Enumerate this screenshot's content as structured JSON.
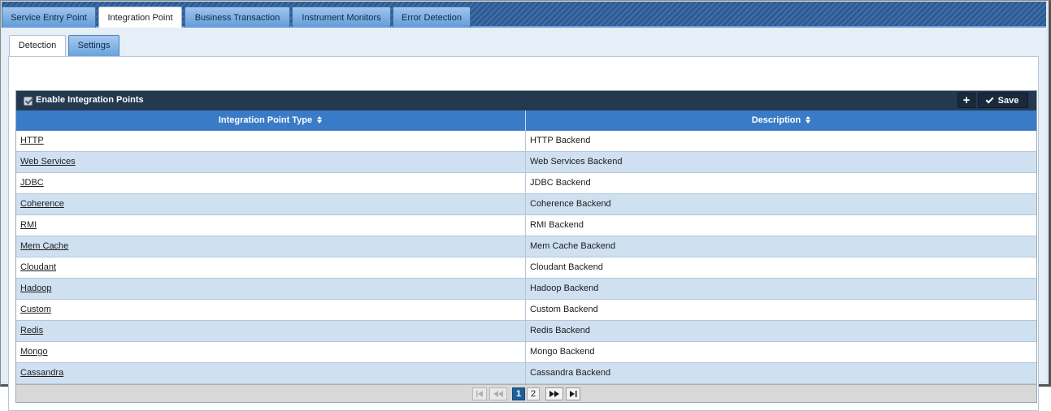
{
  "top_tabs": [
    {
      "label": "Service Entry Point",
      "active": false
    },
    {
      "label": "Integration Point",
      "active": true
    },
    {
      "label": "Business Transaction",
      "active": false
    },
    {
      "label": "Instrument Monitors",
      "active": false
    },
    {
      "label": "Error Detection",
      "active": false
    }
  ],
  "sub_tabs": [
    {
      "label": "Detection",
      "active": true
    },
    {
      "label": "Settings",
      "active": false
    }
  ],
  "toolbar": {
    "enable_label": "Enable Integration Points",
    "enable_checked": true,
    "add_icon": "plus-icon",
    "save_label": "Save",
    "save_icon": "check-icon"
  },
  "table": {
    "columns": [
      "Integration Point Type",
      "Description"
    ],
    "rows": [
      {
        "type": "HTTP",
        "description": "HTTP Backend"
      },
      {
        "type": "Web Services",
        "description": "Web Services Backend"
      },
      {
        "type": "JDBC",
        "description": "JDBC Backend"
      },
      {
        "type": "Coherence",
        "description": "Coherence Backend"
      },
      {
        "type": "RMI",
        "description": "RMI Backend"
      },
      {
        "type": "Mem Cache",
        "description": "Mem Cache Backend"
      },
      {
        "type": "Cloudant",
        "description": "Cloudant Backend"
      },
      {
        "type": "Hadoop",
        "description": "Hadoop Backend"
      },
      {
        "type": "Custom",
        "description": "Custom Backend"
      },
      {
        "type": "Redis",
        "description": "Redis Backend"
      },
      {
        "type": "Mongo",
        "description": "Mongo Backend"
      },
      {
        "type": "Cassandra",
        "description": "Cassandra Backend"
      }
    ]
  },
  "pager": {
    "first_icon": "first-page-icon",
    "prev_icon": "prev-page-icon",
    "pages": [
      "1",
      "2"
    ],
    "current_page": "1",
    "next_icon": "next-page-icon",
    "last_icon": "last-page-icon"
  },
  "colors": {
    "tab_bar": "#2b5b95",
    "toolbar": "#243850",
    "header": "#3a7bc8",
    "row_alt": "#cfe0f1",
    "current_page": "#1f5f99"
  }
}
